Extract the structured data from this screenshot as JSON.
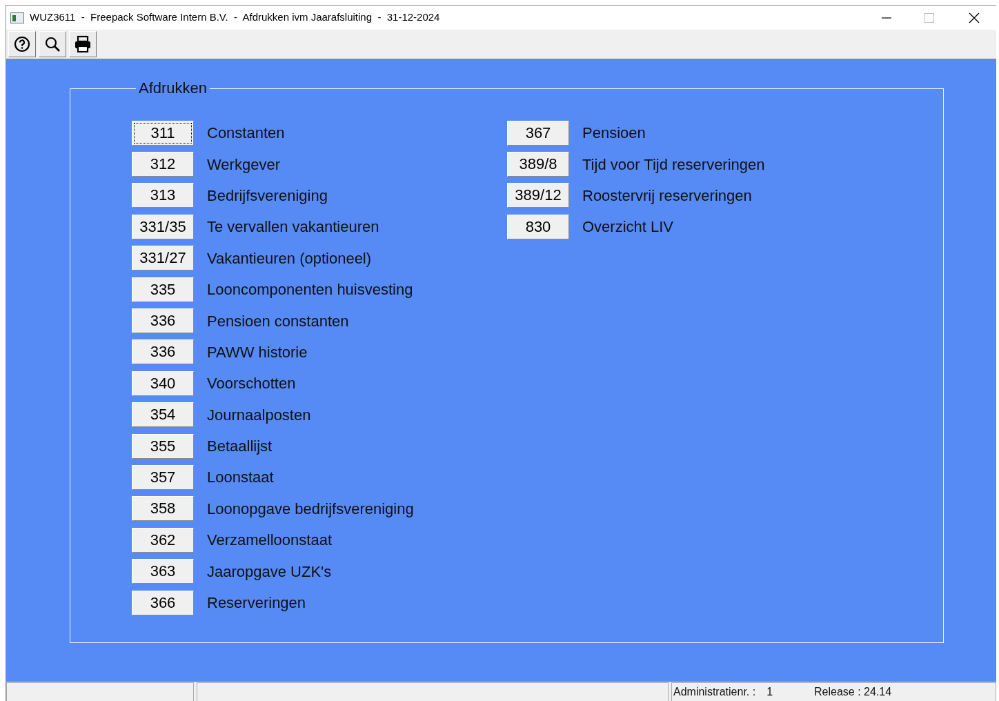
{
  "window": {
    "title": "WUZ3611  -  Freepack Software Intern B.V.  -  Afdrukken ivm Jaarafsluiting  -  31-12-2024"
  },
  "toolbar": [
    {
      "kind": "help"
    },
    {
      "kind": "search"
    },
    {
      "kind": "print"
    }
  ],
  "group": {
    "title": "Afdrukken",
    "columns": [
      [
        {
          "code": "311",
          "label": "Constanten",
          "focused": true
        },
        {
          "code": "312",
          "label": "Werkgever",
          "focused": false
        },
        {
          "code": "313",
          "label": "Bedrijfsvereniging",
          "focused": false
        },
        {
          "code": "331/35",
          "label": "Te vervallen vakantieuren",
          "focused": false
        },
        {
          "code": "331/27",
          "label": "Vakantieuren (optioneel)",
          "focused": false
        },
        {
          "code": "335",
          "label": "Looncomponenten huisvesting",
          "focused": false
        },
        {
          "code": "336",
          "label": "Pensioen constanten",
          "focused": false
        },
        {
          "code": "336",
          "label": "PAWW historie",
          "focused": false
        },
        {
          "code": "340",
          "label": "Voorschotten",
          "focused": false
        },
        {
          "code": "354",
          "label": "Journaalposten",
          "focused": false
        },
        {
          "code": "355",
          "label": "Betaallijst",
          "focused": false
        },
        {
          "code": "357",
          "label": "Loonstaat",
          "focused": false
        },
        {
          "code": "358",
          "label": "Loonopgave bedrijfsvereniging",
          "focused": false
        },
        {
          "code": "362",
          "label": "Verzamelloonstaat",
          "focused": false
        },
        {
          "code": "363",
          "label": "Jaaropgave UZK's",
          "focused": false
        },
        {
          "code": "366",
          "label": "Reserveringen",
          "focused": false
        }
      ],
      [
        {
          "code": "367",
          "label": "Pensioen",
          "focused": false
        },
        {
          "code": "389/8",
          "label": "Tijd voor Tijd reserveringen",
          "focused": false
        },
        {
          "code": "389/12",
          "label": "Roostervrij reserveringen",
          "focused": false
        },
        {
          "code": "830",
          "label": "Overzicht LIV",
          "focused": false
        }
      ]
    ]
  },
  "status_bar": {
    "administration_label": "Administratienr. :",
    "administration_number": "1",
    "release": "Release : 24.14"
  }
}
